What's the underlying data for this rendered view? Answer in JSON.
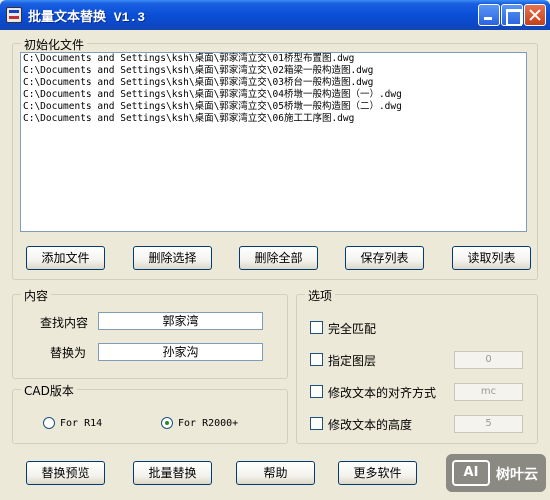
{
  "window": {
    "title": "批量文本替换 V1.3"
  },
  "files_group": {
    "title": "初始化文件",
    "items": [
      "C:\\Documents and Settings\\ksh\\桌面\\郭家湾立交\\01桥型布置图.dwg",
      "C:\\Documents and Settings\\ksh\\桌面\\郭家湾立交\\02箱梁一般构造图.dwg",
      "C:\\Documents and Settings\\ksh\\桌面\\郭家湾立交\\03桥台一般构造图.dwg",
      "C:\\Documents and Settings\\ksh\\桌面\\郭家湾立交\\04桥墩一般构造图（一）.dwg",
      "C:\\Documents and Settings\\ksh\\桌面\\郭家湾立交\\05桥墩一般构造图（二）.dwg",
      "C:\\Documents and Settings\\ksh\\桌面\\郭家湾立交\\06施工工序图.dwg"
    ],
    "buttons": {
      "add": "添加文件",
      "delete_selected": "删除选择",
      "delete_all": "删除全部",
      "save_list": "保存列表",
      "read_list": "读取列表"
    }
  },
  "content_group": {
    "title": "内容",
    "find_label": "查找内容",
    "find_value": "郭家湾",
    "replace_label": "替换为",
    "replace_value": "孙家沟"
  },
  "cad_group": {
    "title": "CAD版本",
    "options": [
      "For R14",
      "For R2000+"
    ],
    "selected": "For R2000+"
  },
  "options_group": {
    "title": "选项",
    "full_match": {
      "label": "完全匹配",
      "checked": false
    },
    "layer": {
      "label": "指定图层",
      "checked": false,
      "value": "0"
    },
    "align": {
      "label": "修改文本的对齐方式",
      "checked": false,
      "value": "mc"
    },
    "height": {
      "label": "修改文本的高度",
      "checked": false,
      "value": "5"
    }
  },
  "bottom_buttons": {
    "preview": "替换预览",
    "batch": "批量替换",
    "help": "帮助",
    "more": "更多软件"
  },
  "watermark": {
    "badge": "AI",
    "text": "树叶云"
  }
}
